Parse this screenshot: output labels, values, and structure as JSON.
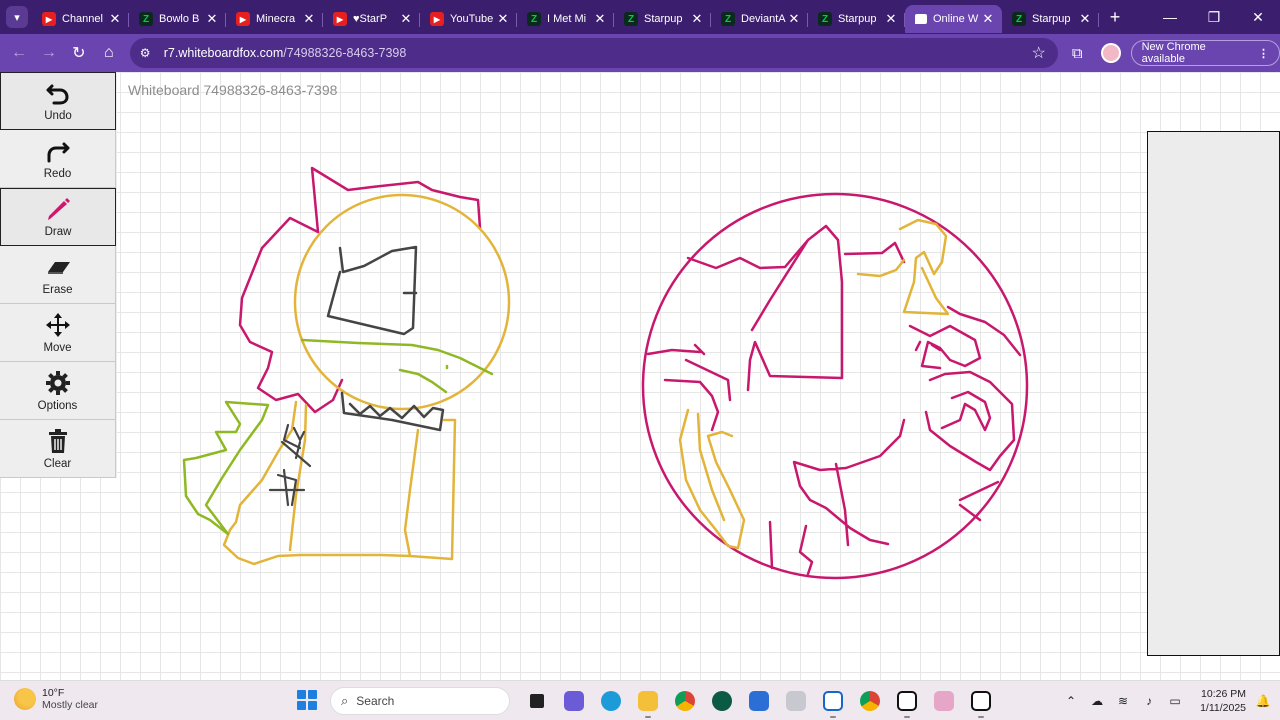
{
  "browser": {
    "tabs": [
      {
        "title": "Channel",
        "favicon": "youtube-icon",
        "active": false
      },
      {
        "title": "Bowlo B",
        "favicon": "deviantart-icon",
        "active": false
      },
      {
        "title": "Minecra",
        "favicon": "youtube-icon",
        "active": false
      },
      {
        "title": "♥StarP",
        "favicon": "youtube-icon",
        "active": false
      },
      {
        "title": "YouTube",
        "favicon": "youtube-icon",
        "active": false
      },
      {
        "title": "I Met Mi",
        "favicon": "deviantart-icon",
        "active": false
      },
      {
        "title": "Starpup",
        "favicon": "deviantart-icon",
        "active": false
      },
      {
        "title": "DeviantA",
        "favicon": "deviantart-icon",
        "active": false
      },
      {
        "title": "Starpup",
        "favicon": "deviantart-icon",
        "active": false
      },
      {
        "title": "Online W",
        "favicon": "whiteboard-icon",
        "active": true
      },
      {
        "title": "Starpup",
        "favicon": "deviantart-icon",
        "active": false
      }
    ],
    "url_host": "r7.whiteboardfox.com",
    "url_path": "/74988326-8463-7398",
    "update_label": "New Chrome available",
    "accent": "#6a45b0"
  },
  "whiteboard": {
    "title": "Whiteboard 74988326-8463-7398",
    "tools": [
      {
        "label": "Undo",
        "icon": "undo-icon",
        "selected": true
      },
      {
        "label": "Redo",
        "icon": "redo-icon",
        "selected": false
      },
      {
        "label": "Draw",
        "icon": "pencil-icon",
        "selected": true
      },
      {
        "label": "Erase",
        "icon": "eraser-icon",
        "selected": false
      },
      {
        "label": "Move",
        "icon": "move-icon",
        "selected": false
      },
      {
        "label": "Options",
        "icon": "gear-icon",
        "selected": false
      },
      {
        "label": "Clear",
        "icon": "trash-icon",
        "selected": false
      }
    ],
    "stroke_colors": {
      "magenta": "#c8186e",
      "yellow": "#e3b43a",
      "green": "#8fb824",
      "gray": "#454545"
    }
  },
  "taskbar": {
    "weather_temp": "10°F",
    "weather_desc": "Mostly clear",
    "search_placeholder": "Search",
    "time": "10:26 PM",
    "date": "1/11/2025"
  }
}
